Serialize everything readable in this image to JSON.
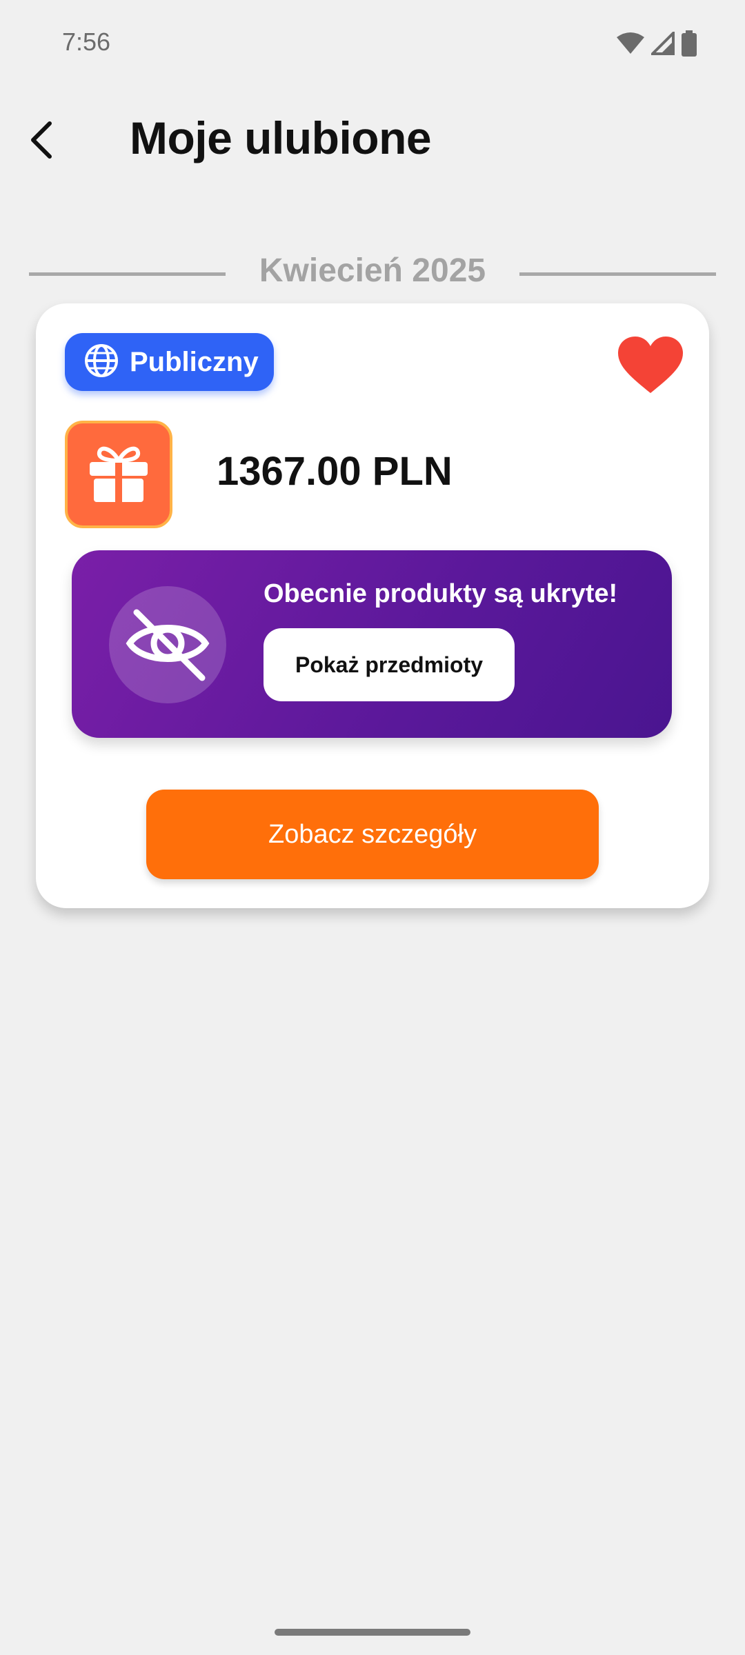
{
  "status_bar": {
    "time": "7:56"
  },
  "header": {
    "title": "Moje ulubione"
  },
  "section": {
    "month": "Kwiecień 2025"
  },
  "card": {
    "visibility_badge": "Publiczny",
    "amount": "1367.00 PLN",
    "hidden_notice": "Obecnie produkty są ukryte!",
    "show_items_label": "Pokaż przedmioty",
    "details_label": "Zobacz szczegóły",
    "favorited": true
  },
  "colors": {
    "badge_blue": "#2f63f6",
    "heart_red": "#f44336",
    "gift_orange": "#ff6a3d",
    "panel_purple": "#5a189a",
    "details_orange": "#ff6f0a"
  },
  "icons": {
    "back": "arrow-left-icon",
    "globe": "globe-icon",
    "heart": "heart-icon",
    "gift": "gift-icon",
    "hidden": "eye-off-icon",
    "wifi": "wifi-icon",
    "signal": "signal-icon",
    "battery": "battery-icon"
  }
}
